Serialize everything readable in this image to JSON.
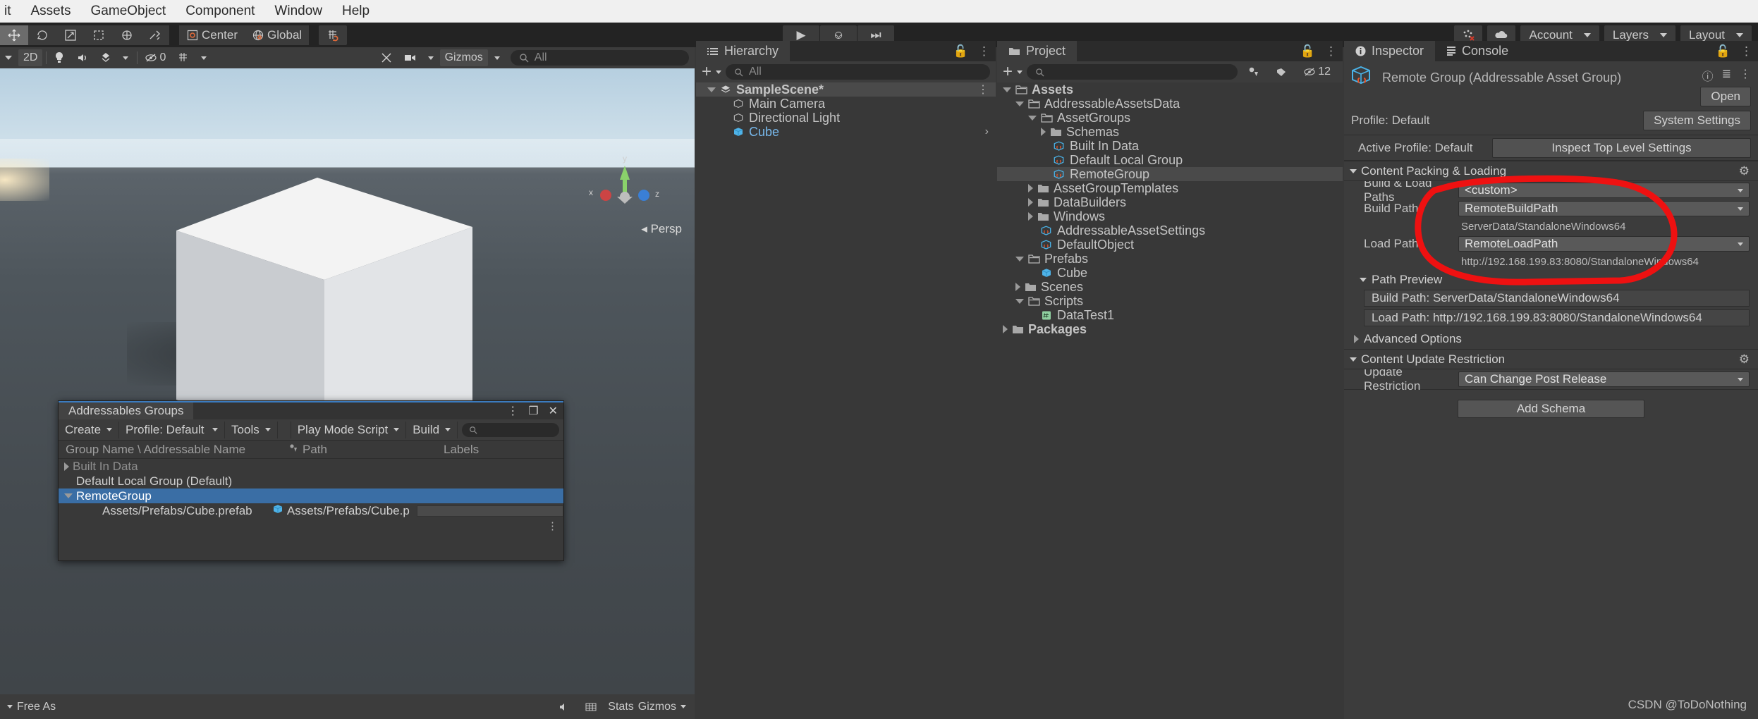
{
  "menubar": {
    "items": [
      "it",
      "Assets",
      "GameObject",
      "Component",
      "Window",
      "Help"
    ]
  },
  "toolbar": {
    "tools": [
      {
        "name": "move-tool",
        "glyph": "✥",
        "selected": true
      },
      {
        "name": "rotate-tool",
        "glyph": "↻",
        "selected": false
      },
      {
        "name": "scale-tool",
        "glyph": "⤡",
        "selected": false
      },
      {
        "name": "rect-tool",
        "glyph": "⬚",
        "selected": false
      },
      {
        "name": "transform-tool",
        "glyph": "⊕",
        "selected": false
      },
      {
        "name": "custom-tool",
        "glyph": "⚒",
        "selected": false
      }
    ],
    "pivot_label": "Center",
    "handle_label": "Global",
    "grid_label": "",
    "play_label": "▶",
    "pause_label": "⎉",
    "step_label": "⏭",
    "collab_label": "",
    "cloud_label": "",
    "account_label": "Account",
    "layers_label": "Layers",
    "layout_label": "Layout"
  },
  "scene_view": {
    "toolbar": {
      "draw_mode": "",
      "two_d_label": "2D",
      "lighting_icon": "light-icon",
      "audio_icon": "audio-icon",
      "fx_icon": "fx-icon",
      "hidden_count": "0",
      "grid_icon": "grid-icon",
      "tools_icon": "scene-tools-icon",
      "camera_icon": "scene-camera-icon",
      "gizmos_label": "Gizmos",
      "search_placeholder": "All"
    },
    "persp_label": "◂ Persp",
    "bottom_bar": {
      "free_aspect_label": "Free As",
      "stats_label": "Stats",
      "gizmos_label": "Gizmos"
    },
    "axis_gizmo": {
      "x": "x",
      "y": "y",
      "z": "z"
    }
  },
  "hierarchy": {
    "tab_label": "Hierarchy",
    "add_label": "+",
    "search_placeholder": "All",
    "items": [
      {
        "label": "SampleScene*",
        "depth": 0,
        "icon": "scene-icon",
        "expanded": true,
        "selected": true,
        "bold": true,
        "menu": true
      },
      {
        "label": "Main Camera",
        "depth": 1,
        "icon": "gameobject-icon",
        "expanded": null,
        "selected": false
      },
      {
        "label": "Directional Light",
        "depth": 1,
        "icon": "gameobject-icon",
        "expanded": null,
        "selected": false
      },
      {
        "label": "Cube",
        "depth": 1,
        "icon": "prefab-icon",
        "expanded": null,
        "selected": false,
        "prefab": true,
        "chevron": "›"
      }
    ]
  },
  "project": {
    "tab_label": "Project",
    "add_label": "+",
    "search_placeholder": "",
    "hidden_count": "12",
    "items": [
      {
        "label": "Assets",
        "depth": 0,
        "icon": "folder-open-icon",
        "expanded": true,
        "bold": true
      },
      {
        "label": "AddressableAssetsData",
        "depth": 1,
        "icon": "folder-open-icon",
        "expanded": true
      },
      {
        "label": "AssetGroups",
        "depth": 2,
        "icon": "folder-open-icon",
        "expanded": true
      },
      {
        "label": "Schemas",
        "depth": 3,
        "icon": "folder-icon",
        "expanded": false
      },
      {
        "label": "Built In Data",
        "depth": 3,
        "icon": "asset-group-icon"
      },
      {
        "label": "Default Local Group",
        "depth": 3,
        "icon": "asset-group-icon"
      },
      {
        "label": "RemoteGroup",
        "depth": 3,
        "icon": "asset-group-icon",
        "selected": true
      },
      {
        "label": "AssetGroupTemplates",
        "depth": 2,
        "icon": "folder-icon",
        "expanded": false
      },
      {
        "label": "DataBuilders",
        "depth": 2,
        "icon": "folder-icon",
        "expanded": false
      },
      {
        "label": "Windows",
        "depth": 2,
        "icon": "folder-icon",
        "expanded": false
      },
      {
        "label": "AddressableAssetSettings",
        "depth": 2,
        "icon": "asset-group-icon"
      },
      {
        "label": "DefaultObject",
        "depth": 2,
        "icon": "asset-group-icon"
      },
      {
        "label": "Prefabs",
        "depth": 1,
        "icon": "folder-open-icon",
        "expanded": true
      },
      {
        "label": "Cube",
        "depth": 2,
        "icon": "prefab-icon"
      },
      {
        "label": "Scenes",
        "depth": 1,
        "icon": "folder-icon",
        "expanded": false
      },
      {
        "label": "Scripts",
        "depth": 1,
        "icon": "folder-open-icon",
        "expanded": true
      },
      {
        "label": "DataTest1",
        "depth": 2,
        "icon": "script-icon"
      },
      {
        "label": "Packages",
        "depth": 0,
        "icon": "folder-icon",
        "expanded": false,
        "bold": true
      }
    ]
  },
  "inspector": {
    "tabs": [
      {
        "label": "Inspector",
        "active": true,
        "icon": "info-icon"
      },
      {
        "label": "Console",
        "active": false,
        "icon": "console-icon"
      }
    ],
    "object_title": "Remote Group (Addressable Asset Group)",
    "open_button": "Open",
    "profile_label": "Profile: Default",
    "system_settings_button": "System Settings",
    "active_profile_label": "Active Profile: Default",
    "inspect_top_level_button": "Inspect Top Level Settings",
    "content_packing": {
      "section_title": "Content Packing & Loading",
      "build_load_paths_label": "Build & Load Paths",
      "build_load_paths_value": "<custom>",
      "build_path_label": "Build Path",
      "build_path_value": "RemoteBuildPath",
      "build_path_preview": "ServerData/StandaloneWindows64",
      "load_path_label": "Load Path",
      "load_path_value": "RemoteLoadPath",
      "load_path_preview": "http://192.168.199.83:8080/StandaloneWindows64",
      "path_preview_label": "Path Preview",
      "preview_build": "Build Path: ServerData/StandaloneWindows64",
      "preview_load": "Load Path: http://192.168.199.83:8080/StandaloneWindows64",
      "advanced_options_label": "Advanced Options"
    },
    "content_update": {
      "section_title": "Content Update Restriction",
      "update_restriction_label": "Update Restriction",
      "update_restriction_value": "Can Change Post Release"
    },
    "add_schema_button": "Add Schema",
    "annotation_color": "#ee1111"
  },
  "addressables_window": {
    "title": "Addressables Groups",
    "toolbar": {
      "create_label": "Create",
      "profile_label": "Profile: Default",
      "tools_label": "Tools",
      "play_mode_script_label": "Play Mode Script",
      "build_label": "Build",
      "search_placeholder": ""
    },
    "columns": [
      "Group Name \\ Addressable Name",
      "Path",
      "Labels"
    ],
    "rows": [
      {
        "name": "Built In Data",
        "kind": "group",
        "expanded": false,
        "dim": true,
        "path": "",
        "selected": false
      },
      {
        "name": "Default Local Group (Default)",
        "kind": "group",
        "expanded": null,
        "path": "",
        "selected": false
      },
      {
        "name": "RemoteGroup",
        "kind": "group",
        "expanded": true,
        "path": "",
        "selected": true
      },
      {
        "name": "Assets/Prefabs/Cube.prefab",
        "kind": "entry",
        "path": "Assets/Prefabs/Cube.p",
        "selected": false,
        "icon": "prefab-icon"
      }
    ],
    "win_buttons": [
      "⋮",
      "❐",
      "✕"
    ]
  },
  "watermark": "CSDN @ToDoNothing"
}
